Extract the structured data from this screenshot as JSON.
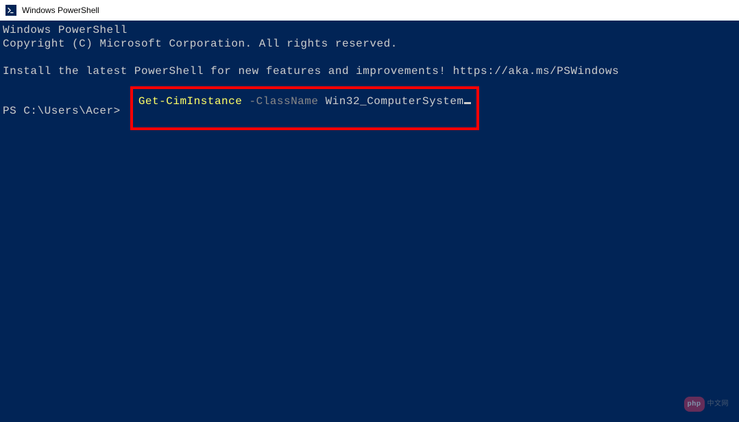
{
  "window": {
    "title": "Windows PowerShell"
  },
  "terminal": {
    "line1": "Windows PowerShell",
    "line2": "Copyright (C) Microsoft Corporation. All rights reserved.",
    "line3": "Install the latest PowerShell for new features and improvements! https://aka.ms/PSWindows",
    "prompt": "PS C:\\Users\\Acer> ",
    "command": {
      "cmdlet": "Get-CimInstance",
      "param": " -ClassName ",
      "value": "Win32_ComputerSystem"
    }
  },
  "watermark": {
    "badge": "php",
    "text": "中文网"
  }
}
